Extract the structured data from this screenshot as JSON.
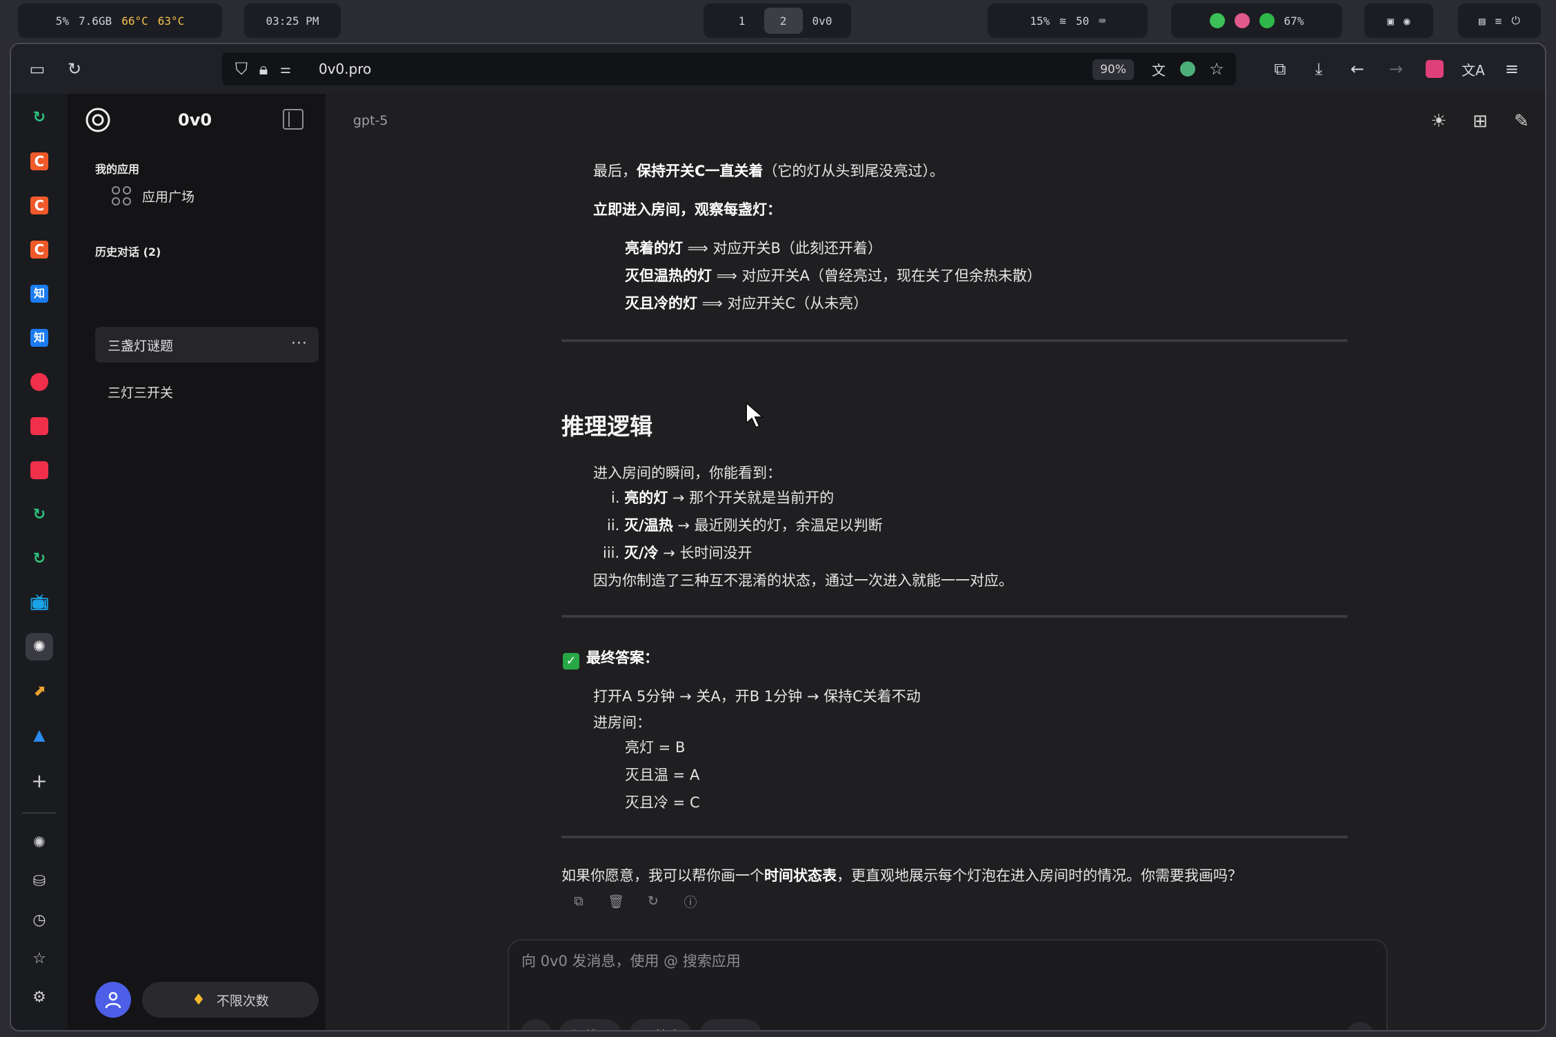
{
  "system_bar": {
    "cpu": "5%",
    "memory": "7.6GB",
    "temp1": "66°C",
    "temp2": "63°C",
    "clock": "03:25 PM",
    "workspaces": [
      "1",
      "2"
    ],
    "active_workspace": "2",
    "window_title": "0v0",
    "brightness": "15%",
    "volume": "50",
    "battery": "67%"
  },
  "browser": {
    "url": "0v0.pro",
    "zoom": "90%"
  },
  "rail": {
    "items": [
      "refresh-green",
      "c-orange",
      "c-orange",
      "c-orange",
      "zhihu",
      "zhihu",
      "xiaohongshu",
      "xiaohongshu",
      "xiaohongshu",
      "refresh-green",
      "refresh-green",
      "bilibili",
      "openai",
      "kling",
      "mountain"
    ]
  },
  "sidebar": {
    "app_name": "0v0",
    "my_apps_label": "我的应用",
    "app_square_label": "应用广场",
    "history_label": "历史对话 (2)",
    "history": [
      "三盏灯谜题",
      "三灯三开关"
    ],
    "plan_label": "不限次数"
  },
  "main": {
    "model": "gpt-5",
    "lines": {
      "l1a": "最后，",
      "l1b": "保持开关C一直关着",
      "l1c": "（它的灯从头到尾没亮过）。",
      "l2": "立即进入房间，观察每盏灯：",
      "l3a": "亮着的灯",
      "l3b": " ⟹ 对应开关B（此刻还开着）",
      "l4a": "灭但温热的灯",
      "l4b": " ⟹ 对应开关A（曾经亮过，现在关了但余热未散）",
      "l5a": "灭且冷的灯",
      "l5b": " ⟹ 对应开关C（从未亮）",
      "heading": "推理逻辑",
      "l6": "进入房间的瞬间，你能看到：",
      "l7n": "i.",
      "l7a": "亮的灯",
      "l7b": " → 那个开关就是当前开的",
      "l8n": "ii.",
      "l8a": "灭/温热",
      "l8b": " → 最近刚关的灯，余温足以判断",
      "l9n": "iii.",
      "l9a": "灭/冷",
      "l9b": " → 长时间没开",
      "l10": "因为你制造了三种互不混淆的状态，通过一次进入就能一一对应。",
      "final_label": "最终答案：",
      "l11": "打开A 5分钟 → 关A，开B 1分钟 → 保持C关着不动",
      "l12": "进房间：",
      "l13": "亮灯 = B",
      "l14": "灭且温 = A",
      "l15": "灭且冷 = C",
      "l16a": "如果你愿意，我可以帮你画一个",
      "l16b": "时间状态表",
      "l16c": "，更直观地展示每个灯泡在进入房间时的情况。你需要我画吗？"
    },
    "composer": {
      "placeholder": "向 0v0 发消息，使用 @ 搜索应用",
      "reason_label": "推理",
      "search_label": "搜索",
      "tools_label": "工具"
    }
  }
}
